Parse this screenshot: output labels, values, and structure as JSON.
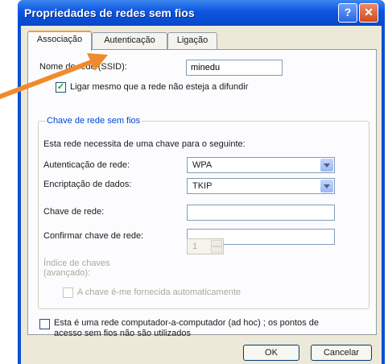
{
  "window": {
    "title": "Propriedades de redes sem fios",
    "help_label": "?",
    "close_label": "✕"
  },
  "tabs": [
    {
      "label": "Associação",
      "active": true
    },
    {
      "label": "Autenticação",
      "active": false
    },
    {
      "label": "Ligação",
      "active": false
    }
  ],
  "association": {
    "ssid_label": "Nome de rede (SSID):",
    "ssid_value": "minedu",
    "connect_when_not_broadcasting_label": "Ligar mesmo que a rede não esteja a difundir",
    "connect_when_not_broadcasting_checked": true,
    "key_group_title": "Chave de rede sem fios",
    "key_required_text": "Esta rede necessita de uma chave para o seguinte:",
    "auth_label": "Autenticação de rede:",
    "auth_value": "WPA",
    "encryption_label": "Encriptação de dados:",
    "encryption_value": "TKIP",
    "network_key_label": "Chave de rede:",
    "network_key_value": "",
    "confirm_key_label": "Confirmar chave de rede:",
    "confirm_key_value": "",
    "key_index_label": "Índice de chaves (avançado):",
    "key_index_value": "1",
    "key_auto_label": "A chave é-me fornecida automaticamente",
    "key_auto_checked": false,
    "adhoc_label": "Esta é uma rede computador-a-computador (ad hoc) ; os pontos de acesso sem fios não são utilizados",
    "adhoc_checked": false
  },
  "buttons": {
    "ok": "OK",
    "cancel": "Cancelar"
  },
  "annotation": {
    "color": "#f08a2c"
  }
}
